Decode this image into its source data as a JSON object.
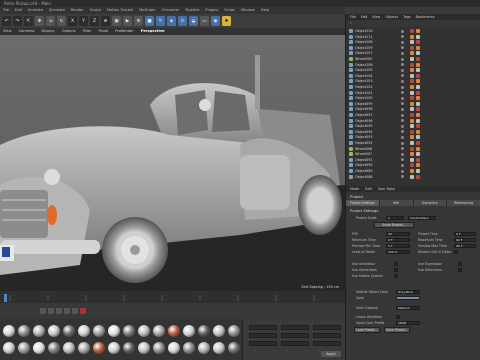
{
  "window": {
    "title": "Retro Pickup.c4d - Main"
  },
  "menubar": [
    "File",
    "Edit",
    "Animate",
    "Simulate",
    "Render",
    "Sculpt",
    "Motion Tracker",
    "MoGraph",
    "Character",
    "Pipeline",
    "Plugins",
    "Script",
    "Window",
    "Help"
  ],
  "toolbar": {
    "undo_icon": "undo-icon",
    "x_axis": "X",
    "y_axis": "Y",
    "z_axis": "Z"
  },
  "viewport": {
    "menu": [
      "View",
      "Cameras",
      "Display",
      "Options",
      "Filter",
      "Panel",
      "ProRender"
    ],
    "label": "Perspective",
    "grid_spacing": "Grid Spacing : 100 cm"
  },
  "object_manager": {
    "tabs": [
      "File",
      "Edit",
      "View",
      "Objects",
      "Tags",
      "Bookmarks"
    ],
    "objects": [
      "Object110",
      "Object111",
      "Object108",
      "Object109",
      "Object107",
      "Wheel009",
      "Object106",
      "Object105",
      "Object104",
      "Object103",
      "Object102",
      "Object101",
      "Object100",
      "Object099",
      "Object098",
      "Object097",
      "Object096",
      "Object095",
      "Object094",
      "Object093",
      "Object092",
      "Wheel008",
      "Wheel007",
      "Object091",
      "Object090",
      "Object089",
      "Object088"
    ]
  },
  "attribute_manager": {
    "menu": [
      "Mode",
      "Edit",
      "User Data"
    ],
    "title": "Project",
    "tabs": [
      "Project Settings",
      "Info",
      "Dynamics",
      "Referencing"
    ],
    "section": "Project Settings",
    "project_scale_label": "Project Scale",
    "project_scale_value": "1",
    "project_scale_unit": "Centimeters",
    "scale_button": "Scale Project...",
    "left_fields": [
      {
        "label": "FPS",
        "value": "30"
      },
      {
        "label": "Minimum Time",
        "value": "0 F"
      },
      {
        "label": "Preview Min Time",
        "value": "0 F"
      },
      {
        "label": "Level of Detail",
        "value": "100 %"
      }
    ],
    "right_fields": [
      {
        "label": "Project Time",
        "value": "0 F"
      },
      {
        "label": "Maximum Time",
        "value": "90 F"
      },
      {
        "label": "Preview Max Time",
        "value": "90 F"
      },
      {
        "label": "Render LOD in Editor",
        "value": ""
      }
    ],
    "check_left": [
      "Use Animation",
      "Use Generators",
      "Use Motion System"
    ],
    "check_right": [
      "Use Expression",
      "Use Deformers"
    ],
    "default_color_label": "Default Object Color",
    "default_color_value": "Gray-Blue",
    "color_label": "Color",
    "view_clipping_label": "View Clipping",
    "view_clipping_value": "Medium",
    "linear_workflow_label": "Linear Workflow",
    "input_color_label": "Input Color Profile",
    "input_color_value": "sRGB",
    "load_preset": "Load Preset...",
    "save_preset": "Save Preset..."
  },
  "coordinates": {
    "apply": "Apply"
  },
  "colors": {
    "accent": "#4670a8",
    "tag_red": "#b84a3a",
    "tag_orange": "#d88a3a"
  }
}
